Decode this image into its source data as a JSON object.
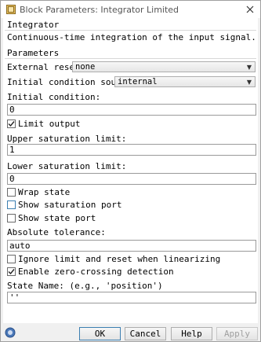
{
  "window": {
    "title": "Block Parameters: Integrator Limited"
  },
  "block": {
    "group_title": "Integrator",
    "description": "Continuous-time integration of the input signal."
  },
  "parameters": {
    "group_title": "Parameters",
    "external_reset": {
      "label": "External reset:",
      "value": "none"
    },
    "ic_source": {
      "label": "Initial condition source:",
      "value": "internal"
    },
    "initial_condition": {
      "label": "Initial condition:",
      "value": "0"
    },
    "limit_output": {
      "label": "Limit output",
      "checked": true
    },
    "upper_limit": {
      "label": "Upper saturation limit:",
      "value": "1"
    },
    "lower_limit": {
      "label": "Lower saturation limit:",
      "value": "0"
    },
    "wrap_state": {
      "label": "Wrap state",
      "checked": false
    },
    "show_saturation_port": {
      "label": "Show saturation port",
      "checked": false
    },
    "show_state_port": {
      "label": "Show state port",
      "checked": false
    },
    "absolute_tolerance": {
      "label": "Absolute tolerance:",
      "value": "auto"
    },
    "ignore_limit": {
      "label": "Ignore limit and reset when linearizing",
      "checked": false
    },
    "zero_crossing": {
      "label": "Enable zero-crossing detection",
      "checked": true
    },
    "state_name": {
      "label": "State Name: (e.g., 'position')",
      "value": "''"
    }
  },
  "buttons": {
    "ok": "OK",
    "cancel": "Cancel",
    "help": "Help",
    "apply": "Apply"
  },
  "icons": {
    "title": "simulink-block-icon",
    "close": "close-icon",
    "help": "help-circle-icon",
    "check": "checkmark-icon",
    "dropdown": "chevron-down-icon"
  },
  "colors": {
    "accent": "#3c7fb1",
    "disabled_text": "#a0a0a0"
  }
}
